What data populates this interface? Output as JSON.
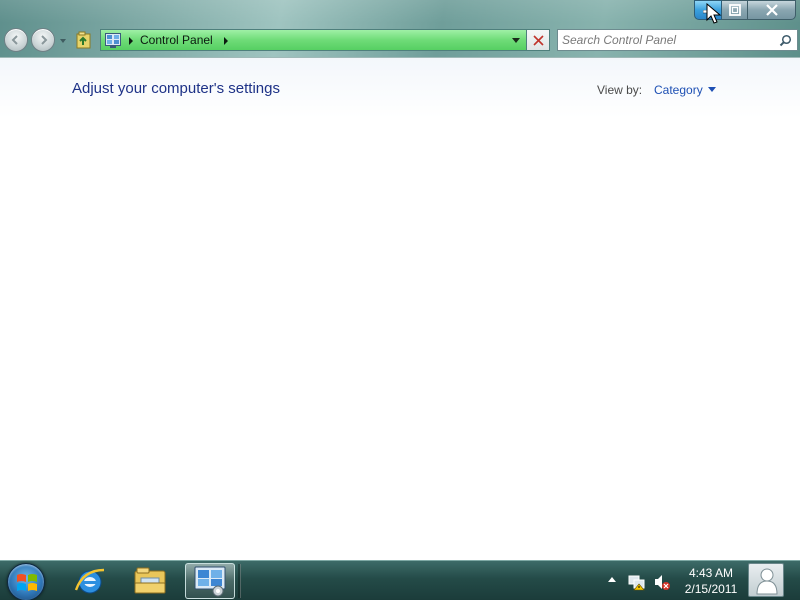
{
  "window": {
    "address": {
      "crumb": "Control Panel",
      "icon": "control-panel-icon"
    },
    "search": {
      "placeholder": "Search Control Panel"
    },
    "caption_buttons": [
      "minimize",
      "maximize",
      "close"
    ]
  },
  "content": {
    "title": "Adjust your computer's settings",
    "view_by_label": "View by:",
    "view_by_value": "Category"
  },
  "taskbar": {
    "pinned": [
      "start-orb",
      "internet-explorer-icon",
      "windows-explorer-icon",
      "control-panel-icon"
    ],
    "active": "control-panel-icon",
    "tray_icons": [
      "show-hidden-icons-arrow",
      "network-icon",
      "volume-muted-icon"
    ],
    "clock": {
      "time": "4:43 AM",
      "date": "2/15/2011"
    }
  },
  "colors": {
    "address_bar": "#6fdc78",
    "title_text": "#1e3287",
    "link_text": "#1e50b4",
    "taskbar": "#244b48"
  }
}
